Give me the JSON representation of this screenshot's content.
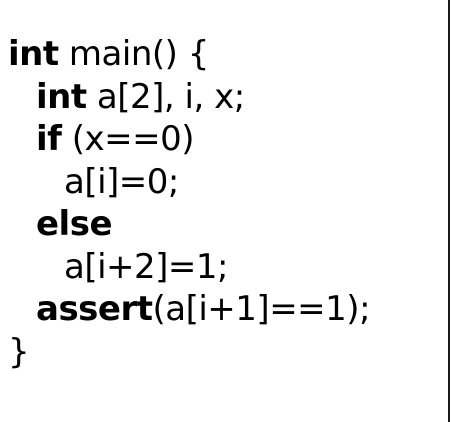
{
  "code_lines": [
    {
      "keyword": "int",
      "rest": " main() {"
    },
    {
      "keyword": "int",
      "rest": " a[2], i, x;"
    },
    {
      "keyword": "if",
      "rest": " (x==0)"
    },
    {
      "keyword": "",
      "rest": "a[i]=0;"
    },
    {
      "keyword": "else",
      "rest": ""
    },
    {
      "keyword": "",
      "rest": "a[i+2]=1;"
    },
    {
      "keyword": "assert",
      "rest": "(a[i+1]==1);"
    },
    {
      "keyword": "",
      "rest": "}"
    }
  ]
}
